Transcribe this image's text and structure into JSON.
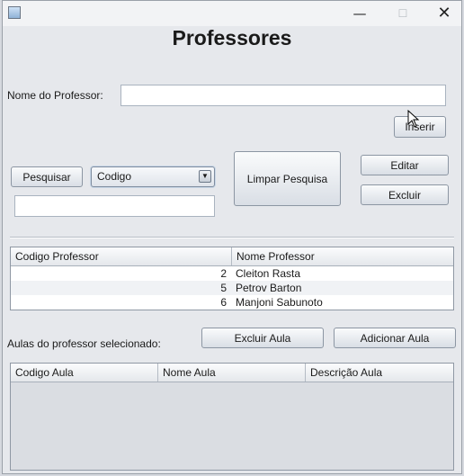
{
  "window": {
    "title": "Professores",
    "controls": {
      "minimize": "—",
      "maximize": "☐",
      "close": "✕"
    }
  },
  "form": {
    "nome_label": "Nome do Professor:",
    "nome_value": "",
    "inserir": "Inserir"
  },
  "search": {
    "pesquisar": "Pesquisar",
    "combo_selected": "Codigo",
    "search_value": "",
    "limpar": "Limpar Pesquisa",
    "editar": "Editar",
    "excluir": "Excluir"
  },
  "professores_table": {
    "columns": [
      "Codigo Professor",
      "Nome Professor"
    ],
    "rows": [
      {
        "codigo": "2",
        "nome": "Cleiton Rasta"
      },
      {
        "codigo": "5",
        "nome": "Petrov Barton"
      },
      {
        "codigo": "6",
        "nome": "Manjoni Sabunoto"
      }
    ]
  },
  "aulas": {
    "label": "Aulas do professor selecionado:",
    "excluir_aula": "Excluir Aula",
    "adicionar_aula": "Adicionar Aula",
    "columns": [
      "Codigo Aula",
      "Nome Aula",
      "Descrição Aula"
    ]
  }
}
